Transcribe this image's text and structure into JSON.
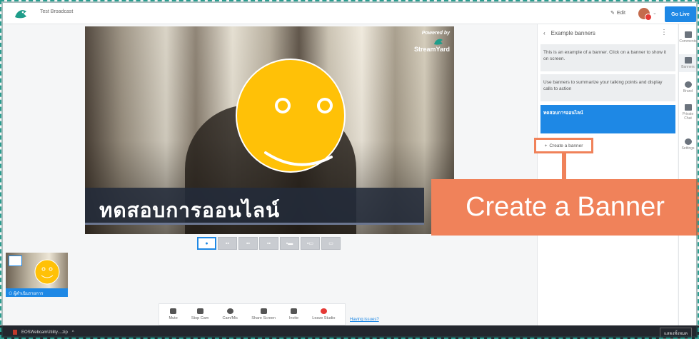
{
  "header": {
    "title": "Test Broadcast",
    "edit_label": "Edit",
    "go_live_label": "Go Live"
  },
  "stage": {
    "powered_by": "Powered by",
    "brand": "StreamYard",
    "banner_text": "ทดสอบการออนไลน์"
  },
  "side_panel": {
    "title": "Example banners",
    "banners": [
      "This is an example of a banner. Click on a banner to show it on screen.",
      "Use banners to summarize your talking points and display calls to action",
      "ทดสอบการออนไลน์"
    ],
    "create_banner_label": "Create a banner"
  },
  "rail": {
    "items": [
      "Comments",
      "Banners",
      "Brand",
      "Private Chat",
      "Settings"
    ]
  },
  "callout": {
    "text": "Create a Banner"
  },
  "thumbnail": {
    "name": "ผู้ดำเนินรายการ"
  },
  "controls": {
    "buttons": [
      "Mute",
      "Stop Cam",
      "Cam/Mic",
      "Share Screen",
      "Invite",
      "Leave Studio"
    ],
    "issues_link": "Having issues?"
  },
  "taskbar": {
    "file_name": "EOSWebcamUtility....zip",
    "show_all": "แสดงทั้งหมด"
  },
  "colors": {
    "accent": "#1e88e5",
    "callout": "#f0825a",
    "smiley": "#ffc107"
  }
}
